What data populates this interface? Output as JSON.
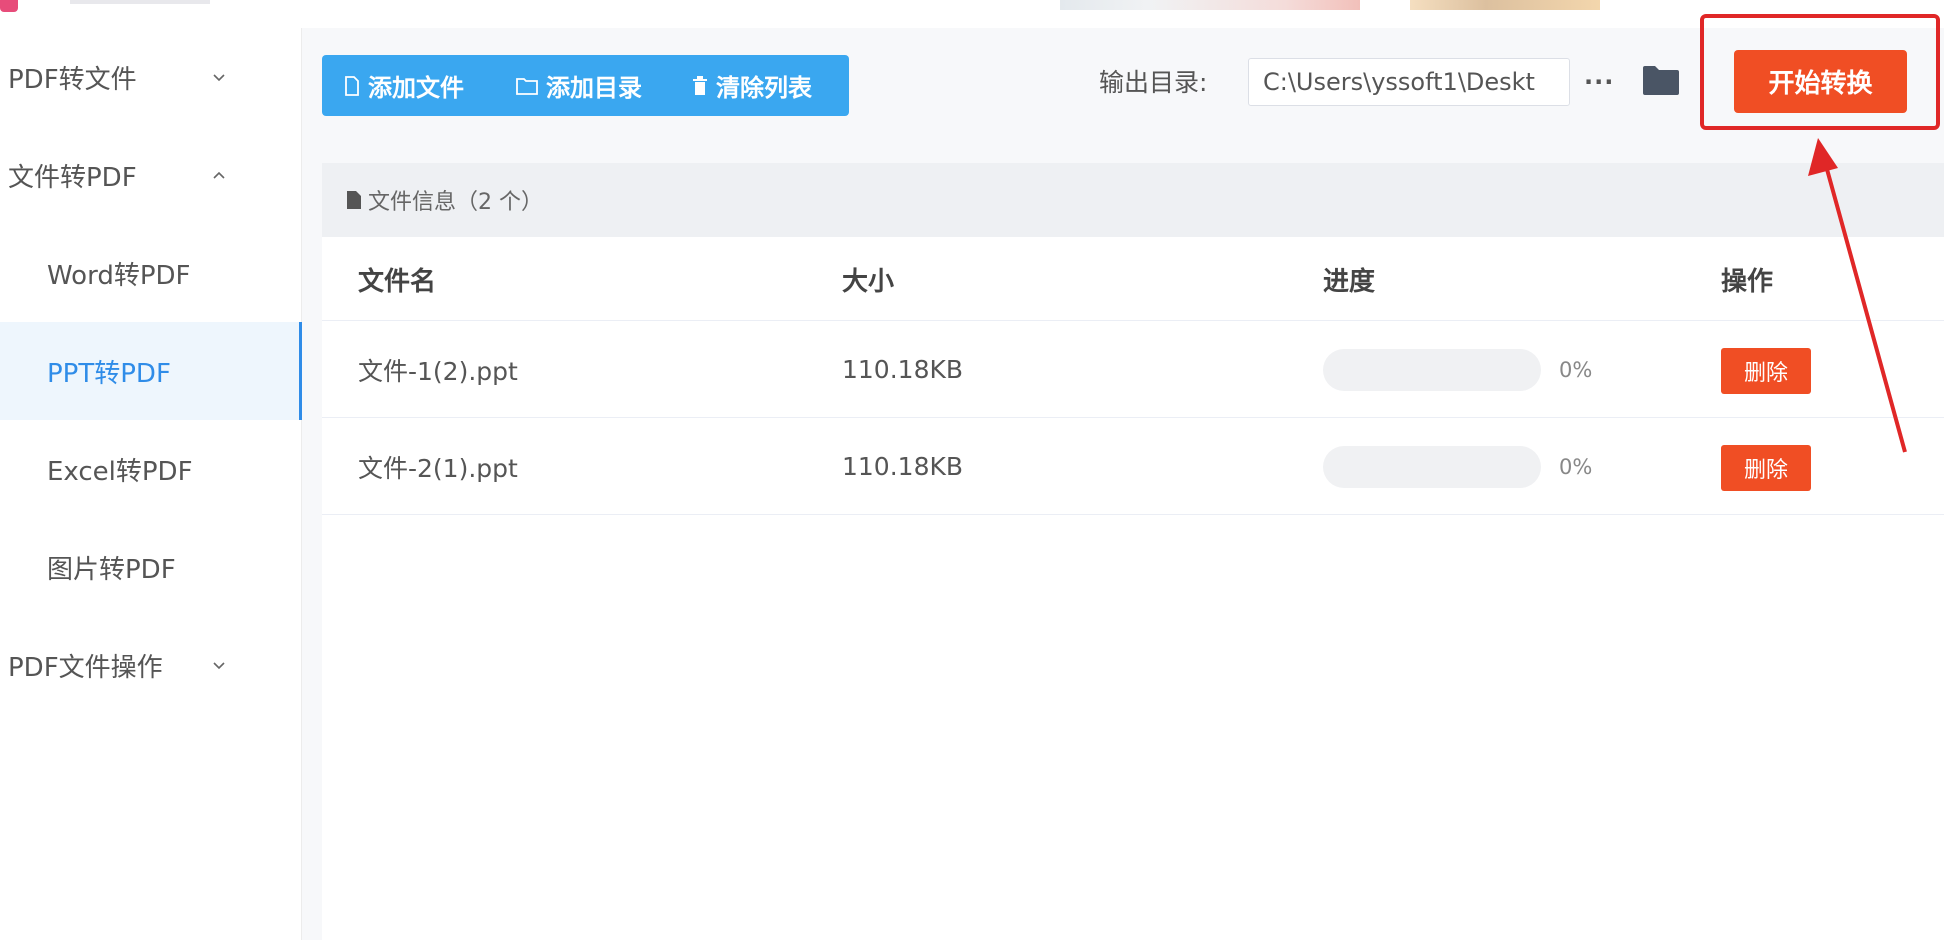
{
  "window": {
    "logo_color": "#e74c7a"
  },
  "sidebar": {
    "items": [
      {
        "label": "PDF转文件",
        "type": "group",
        "chevron": "chevron-down-icon"
      },
      {
        "label": "文件转PDF",
        "type": "group",
        "chevron": "chevron-up-icon"
      },
      {
        "label": "Word转PDF",
        "type": "sub"
      },
      {
        "label": "PPT转PDF",
        "type": "sub",
        "active": true
      },
      {
        "label": "Excel转PDF",
        "type": "sub"
      },
      {
        "label": "图片转PDF",
        "type": "sub"
      },
      {
        "label": "PDF文件操作",
        "type": "group",
        "chevron": "chevron-down-icon"
      }
    ]
  },
  "toolbar": {
    "add_file_label": "添加文件",
    "add_dir_label": "添加目录",
    "clear_list_label": "清除列表",
    "output_dir_label": "输出目录:",
    "output_dir_value": "C:\\Users\\yssoft1\\Deskt",
    "more_label": "···",
    "start_label": "开始转换"
  },
  "table": {
    "info_title": "文件信息（2 个）",
    "headers": {
      "name": "文件名",
      "size": "大小",
      "progress": "进度",
      "action": "操作"
    },
    "rows": [
      {
        "name": "文件-1(2).ppt",
        "size": "110.18KB",
        "progress": 0,
        "progress_label": "0%",
        "action": "删除"
      },
      {
        "name": "文件-2(1).ppt",
        "size": "110.18KB",
        "progress": 0,
        "progress_label": "0%",
        "action": "删除"
      }
    ]
  },
  "colors": {
    "accent_blue": "#3aa7f0",
    "action_red": "#f04e24",
    "highlight_red": "#e02727",
    "active_item": "#2f8ce8"
  }
}
